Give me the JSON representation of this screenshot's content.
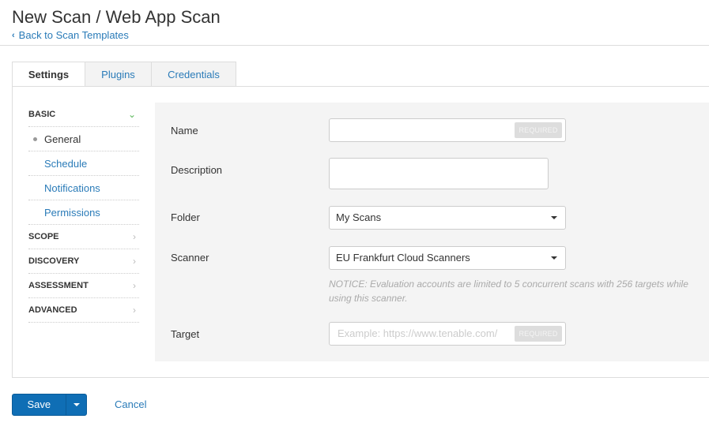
{
  "header": {
    "title": "New Scan / Web App Scan",
    "back_link": "Back to Scan Templates"
  },
  "tabs": [
    {
      "label": "Settings",
      "active": true
    },
    {
      "label": "Plugins",
      "active": false
    },
    {
      "label": "Credentials",
      "active": false
    }
  ],
  "sidebar": {
    "sections": [
      {
        "label": "BASIC",
        "expanded": true
      },
      {
        "label": "SCOPE",
        "expanded": false
      },
      {
        "label": "DISCOVERY",
        "expanded": false
      },
      {
        "label": "ASSESSMENT",
        "expanded": false
      },
      {
        "label": "ADVANCED",
        "expanded": false
      }
    ],
    "basic_items": [
      {
        "label": "General",
        "current": true
      },
      {
        "label": "Schedule",
        "current": false
      },
      {
        "label": "Notifications",
        "current": false
      },
      {
        "label": "Permissions",
        "current": false
      }
    ]
  },
  "form": {
    "name": {
      "label": "Name",
      "value": "",
      "badge": "REQUIRED"
    },
    "description": {
      "label": "Description",
      "value": ""
    },
    "folder": {
      "label": "Folder",
      "value": "My Scans"
    },
    "scanner": {
      "label": "Scanner",
      "value": "EU Frankfurt Cloud Scanners"
    },
    "notice": "NOTICE: Evaluation accounts are limited to 5 concurrent scans with 256 targets while using this scanner.",
    "target": {
      "label": "Target",
      "placeholder": "Example: https://www.tenable.com/",
      "badge": "REQUIRED"
    }
  },
  "footer": {
    "save_label": "Save",
    "cancel_label": "Cancel"
  },
  "colors": {
    "link": "#2a7bb8",
    "primary_button": "#0f6eb5",
    "expanded_chevron": "#5cb85c"
  }
}
